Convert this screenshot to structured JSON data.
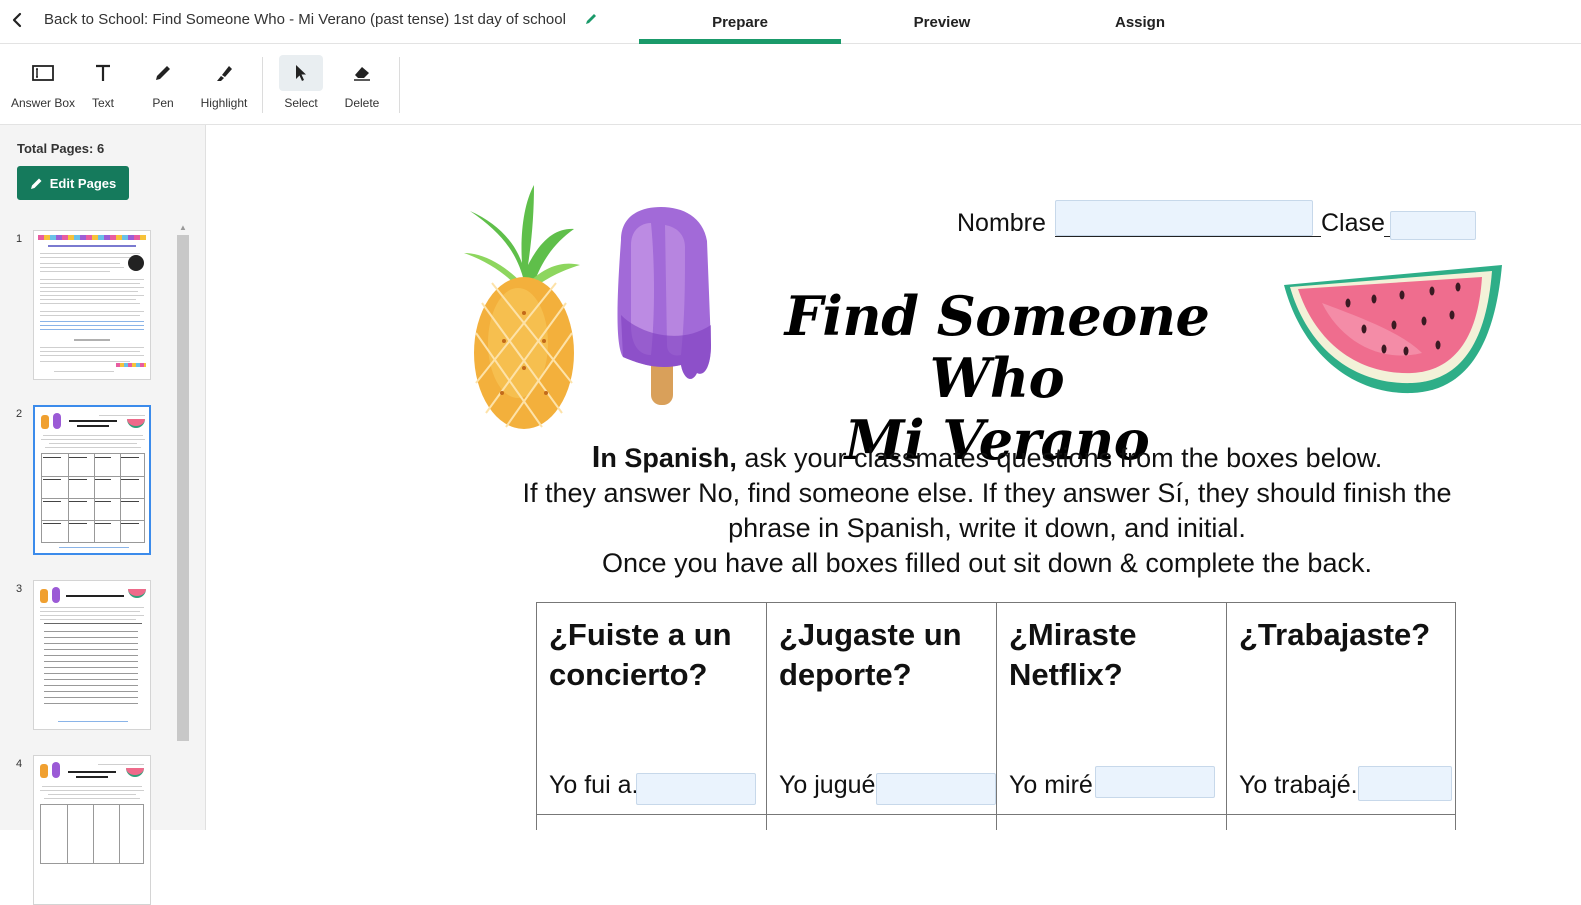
{
  "header": {
    "doc_title": "Back to School: Find Someone Who - Mi Verano (past tense) 1st day of school",
    "tabs": [
      {
        "label": "Prepare",
        "active": true
      },
      {
        "label": "Preview",
        "active": false
      },
      {
        "label": "Assign",
        "active": false
      }
    ],
    "accent": "#1a9a6a"
  },
  "toolbar": {
    "tools": [
      {
        "label": "Answer Box",
        "icon": "answer-box-icon"
      },
      {
        "label": "Text",
        "icon": "text-icon"
      },
      {
        "label": "Pen",
        "icon": "pen-icon"
      },
      {
        "label": "Highlight",
        "icon": "highlight-icon"
      },
      {
        "label": "Select",
        "icon": "cursor-icon",
        "active": true
      },
      {
        "label": "Delete",
        "icon": "eraser-icon"
      }
    ]
  },
  "sidebar": {
    "total_pages": "Total Pages: 6",
    "edit_pages": "Edit Pages",
    "pages": [
      "1",
      "2",
      "3",
      "4"
    ],
    "selected_page": "2",
    "button_color": "#157a5c",
    "selection_color": "#3b8beb"
  },
  "worksheet": {
    "nombre": "Nombre",
    "clase": "Clase",
    "title_line1": "Find Someone Who",
    "title_line2": "Mi Verano",
    "instr_bold_i": "I",
    "instr_bold_rest": "n Spanish,",
    "instr_line1_rest": " ask your classmates questions from the boxes below.",
    "instr_line2": "If they answer No, find someone else. If they answer Sí, they should finish the phrase in Spanish, write it down, and initial.",
    "instr_line3": "Once you have all boxes filled out sit down & complete the back.",
    "cells": [
      {
        "question": "¿Fuiste a un concierto?",
        "answer": "Yo fui a."
      },
      {
        "question": "¿Jugaste un deporte?",
        "answer": "Yo jugué"
      },
      {
        "question": "¿Miraste Netflix?",
        "answer": "Yo miré"
      },
      {
        "question": "¿Trabajaste?",
        "answer": "Yo trabajé."
      }
    ],
    "answer_box_fill": "#eaf3fd"
  }
}
